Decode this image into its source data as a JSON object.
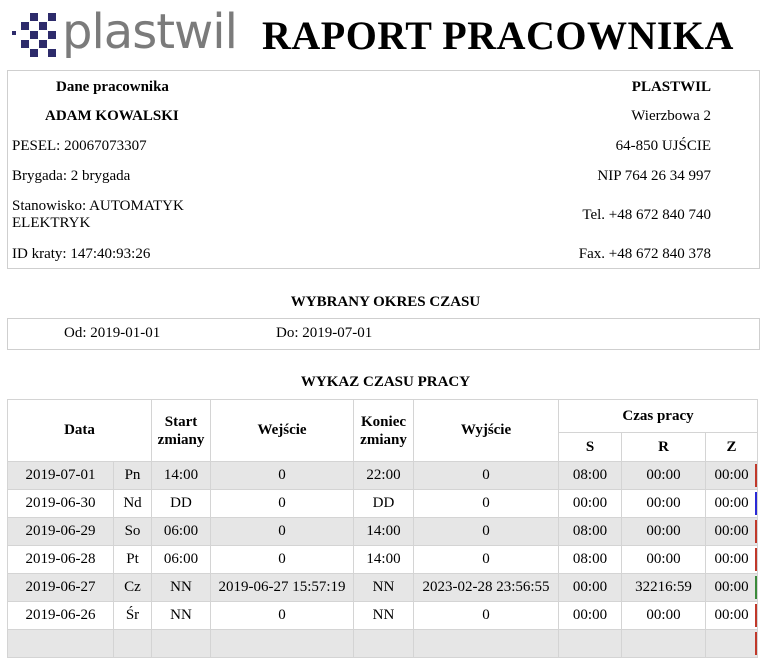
{
  "logo": {
    "text": "plastwil"
  },
  "report_title": "RAPORT PRACOWNIKA",
  "employee": {
    "heading": "Dane pracownika",
    "name": "ADAM KOWALSKI",
    "pesel": "PESEL: 20067073307",
    "brigade": "Brygada: 2 brygada",
    "position": "Stanowisko: AUTOMATYK ELEKTRYK",
    "card_id": "ID kraty: 147:40:93:26"
  },
  "company": {
    "name": "PLASTWIL",
    "street": "Wierzbowa 2",
    "city": "64-850 UJŚCIE",
    "nip": "NIP 764 26 34 997",
    "tel": "Tel. +48 672 840 740",
    "fax": "Fax. +48 672 840 378"
  },
  "period": {
    "heading": "WYBRANY OKRES CZASU",
    "from": "Od: 2019-01-01",
    "to": "Do: 2019-07-01"
  },
  "worktime": {
    "heading": "WYKAZ CZASU PRACY",
    "headers": {
      "date": "Data",
      "shift_start": "Start zmiany",
      "entry": "Wejście",
      "shift_end": "Koniec zmiany",
      "exit": "Wyjście",
      "work_time": "Czas pracy",
      "s": "S",
      "r": "R",
      "z": "Z"
    },
    "rows": [
      {
        "date": "2019-07-01",
        "day": "Pn",
        "start": "14:00",
        "entry": "0",
        "end": "22:00",
        "exit": "0",
        "s": "08:00",
        "r": "00:00",
        "z": "00:00",
        "mark_color": "#c0392b"
      },
      {
        "date": "2019-06-30",
        "day": "Nd",
        "start": "DD",
        "entry": "0",
        "end": "DD",
        "exit": "0",
        "s": "00:00",
        "r": "00:00",
        "z": "00:00",
        "mark_color": "#2a2ad6"
      },
      {
        "date": "2019-06-29",
        "day": "So",
        "start": "06:00",
        "entry": "0",
        "end": "14:00",
        "exit": "0",
        "s": "08:00",
        "r": "00:00",
        "z": "00:00",
        "mark_color": "#c0392b"
      },
      {
        "date": "2019-06-28",
        "day": "Pt",
        "start": "06:00",
        "entry": "0",
        "end": "14:00",
        "exit": "0",
        "s": "08:00",
        "r": "00:00",
        "z": "00:00",
        "mark_color": "#c0392b"
      },
      {
        "date": "2019-06-27",
        "day": "Cz",
        "start": "NN",
        "entry": "2019-06-27 15:57:19",
        "end": "NN",
        "exit": "2023-02-28 23:56:55",
        "s": "00:00",
        "r": "32216:59",
        "z": "00:00",
        "mark_color": "#3a8a3a"
      },
      {
        "date": "2019-06-26",
        "day": "Śr",
        "start": "NN",
        "entry": "0",
        "end": "NN",
        "exit": "0",
        "s": "00:00",
        "r": "00:00",
        "z": "00:00",
        "mark_color": "#c0392b"
      },
      {
        "date": "",
        "day": "",
        "start": "",
        "entry": "",
        "end": "",
        "exit": "",
        "s": "",
        "r": "",
        "z": "",
        "mark_color": "#c0392b"
      }
    ]
  }
}
